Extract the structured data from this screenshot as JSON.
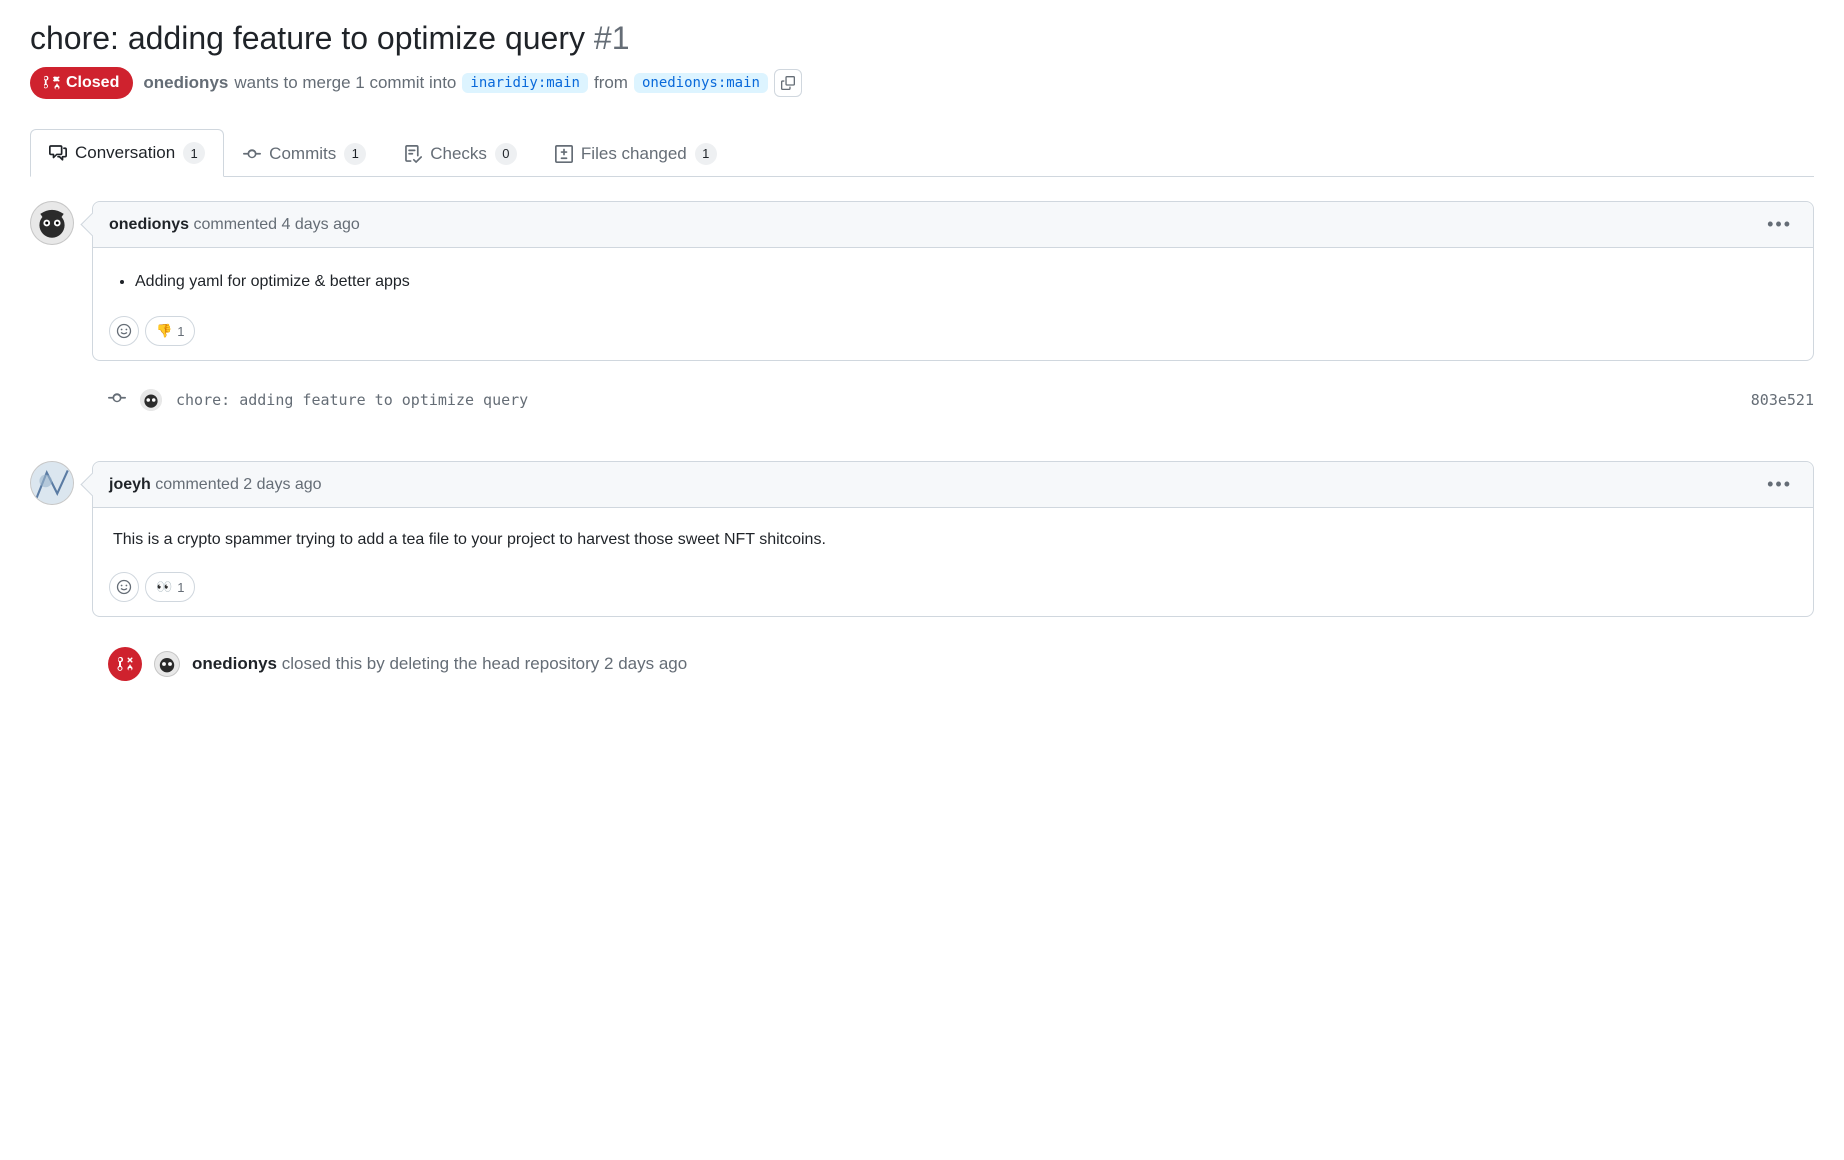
{
  "title": "chore: adding feature to optimize query",
  "issue_number": "#1",
  "state": "Closed",
  "meta": {
    "author": "onedionys",
    "wants_text": "wants to merge 1 commit into",
    "base_branch": "inaridiy:main",
    "from_text": "from",
    "head_branch": "onedionys:main"
  },
  "tabs": {
    "conversation": {
      "label": "Conversation",
      "count": "1"
    },
    "commits": {
      "label": "Commits",
      "count": "1"
    },
    "checks": {
      "label": "Checks",
      "count": "0"
    },
    "files": {
      "label": "Files changed",
      "count": "1"
    }
  },
  "comments": [
    {
      "author": "onedionys",
      "verb": "commented",
      "time": "4 days ago",
      "body_bullet": "Adding yaml for optimize & better apps",
      "reactions": [
        {
          "emoji": "👎",
          "count": "1"
        }
      ]
    },
    {
      "author": "joeyh",
      "verb": "commented",
      "time": "2 days ago",
      "body_text": "This is a crypto spammer trying to add a tea file to your project to harvest those sweet NFT shitcoins.",
      "reactions": [
        {
          "emoji": "👀",
          "count": "1"
        }
      ]
    }
  ],
  "commit": {
    "message": "chore: adding feature to optimize query",
    "sha": "803e521"
  },
  "event": {
    "actor": "onedionys",
    "text": "closed this by deleting the head repository",
    "time": "2 days ago"
  }
}
